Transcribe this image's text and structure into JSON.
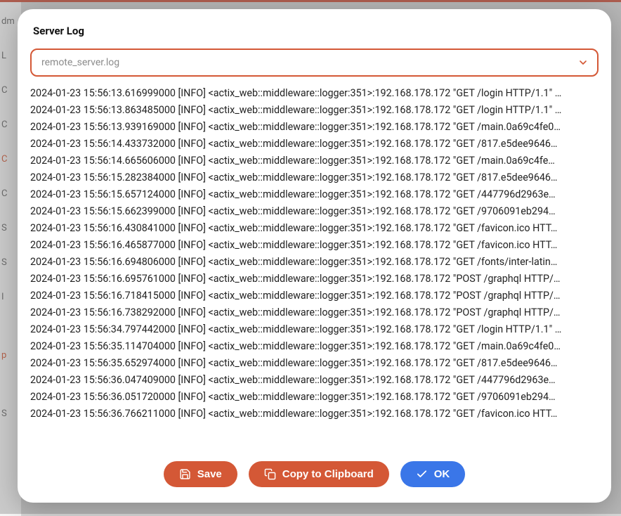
{
  "modal": {
    "title": "Server Log",
    "select": {
      "value": "remote_server.log"
    }
  },
  "logs": [
    "2024-01-23 15:56:13.616999000 [INFO] <actix_web::middleware::logger:351>:192.168.178.172 \"GET /login HTTP/1.1\" …",
    "2024-01-23 15:56:13.863485000 [INFO] <actix_web::middleware::logger:351>:192.168.178.172 \"GET /login HTTP/1.1\" …",
    "2024-01-23 15:56:13.939169000 [INFO] <actix_web::middleware::logger:351>:192.168.178.172 \"GET /main.0a69c4fe0…",
    "2024-01-23 15:56:14.433732000 [INFO] <actix_web::middleware::logger:351>:192.168.178.172 \"GET /817.e5dee9646…",
    "2024-01-23 15:56:14.665606000 [INFO] <actix_web::middleware::logger:351>:192.168.178.172 \"GET /main.0a69c4fe…",
    "2024-01-23 15:56:15.282384000 [INFO] <actix_web::middleware::logger:351>:192.168.178.172 \"GET /817.e5dee9646…",
    "2024-01-23 15:56:15.657124000 [INFO] <actix_web::middleware::logger:351>:192.168.178.172 \"GET /447796d2963e…",
    "2024-01-23 15:56:15.662399000 [INFO] <actix_web::middleware::logger:351>:192.168.178.172 \"GET /9706091eb294…",
    "2024-01-23 15:56:16.430841000 [INFO] <actix_web::middleware::logger:351>:192.168.178.172 \"GET /favicon.ico HTT…",
    "2024-01-23 15:56:16.465877000 [INFO] <actix_web::middleware::logger:351>:192.168.178.172 \"GET /favicon.ico HTT…",
    "2024-01-23 15:56:16.694806000 [INFO] <actix_web::middleware::logger:351>:192.168.178.172 \"GET /fonts/inter-latin…",
    "2024-01-23 15:56:16.695761000 [INFO] <actix_web::middleware::logger:351>:192.168.178.172 \"POST /graphql HTTP/…",
    "2024-01-23 15:56:16.718415000 [INFO] <actix_web::middleware::logger:351>:192.168.178.172 \"POST /graphql HTTP/…",
    "2024-01-23 15:56:16.738292000 [INFO] <actix_web::middleware::logger:351>:192.168.178.172 \"POST /graphql HTTP/…",
    "2024-01-23 15:56:34.797442000 [INFO] <actix_web::middleware::logger:351>:192.168.178.172 \"GET /login HTTP/1.1\" …",
    "2024-01-23 15:56:35.114704000 [INFO] <actix_web::middleware::logger:351>:192.168.178.172 \"GET /main.0a69c4fe0…",
    "2024-01-23 15:56:35.652974000 [INFO] <actix_web::middleware::logger:351>:192.168.178.172 \"GET /817.e5dee9646…",
    "2024-01-23 15:56:36.047409000 [INFO] <actix_web::middleware::logger:351>:192.168.178.172 \"GET /447796d2963e…",
    "2024-01-23 15:56:36.051720000 [INFO] <actix_web::middleware::logger:351>:192.168.178.172 \"GET /9706091eb294…",
    "2024-01-23 15:56:36.766211000 [INFO] <actix_web::middleware::logger:351>:192.168.178.172 \"GET /favicon.ico HTT…"
  ],
  "buttons": {
    "save": "Save",
    "copy": "Copy to Clipboard",
    "ok": "OK"
  },
  "bg_sidebar": [
    "dm",
    "L",
    "C",
    "C",
    "C",
    "C",
    "S",
    "S",
    "I",
    " ",
    "p",
    " ",
    "S"
  ]
}
